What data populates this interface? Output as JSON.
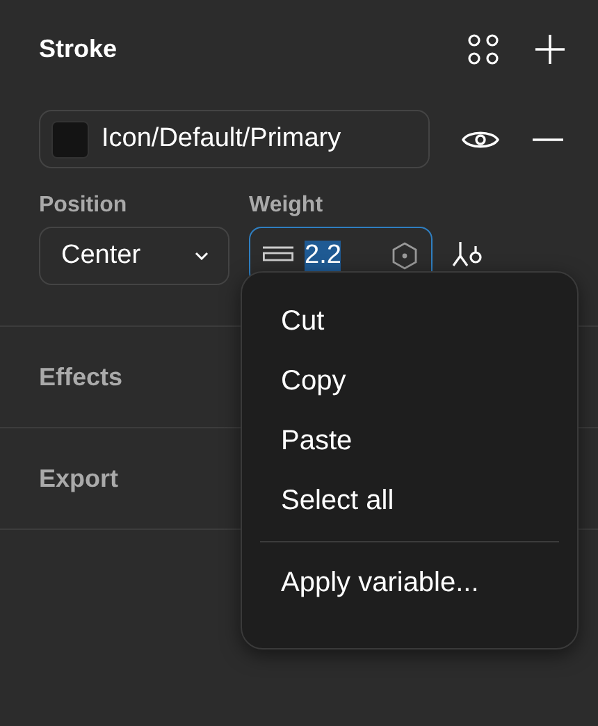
{
  "stroke": {
    "title": "Stroke",
    "color_field": {
      "color": "#141414",
      "value": "Icon/Default/Primary"
    },
    "position": {
      "label": "Position",
      "value": "Center"
    },
    "weight": {
      "label": "Weight",
      "value": "2.2",
      "focused": true
    }
  },
  "sections": [
    {
      "title": "Effects"
    },
    {
      "title": "Export"
    }
  ],
  "context_menu": {
    "groups": [
      {
        "items": [
          {
            "label": "Cut"
          },
          {
            "label": "Copy"
          },
          {
            "label": "Paste"
          },
          {
            "label": "Select all"
          }
        ]
      },
      {
        "items": [
          {
            "label": "Apply variable..."
          }
        ]
      }
    ]
  }
}
